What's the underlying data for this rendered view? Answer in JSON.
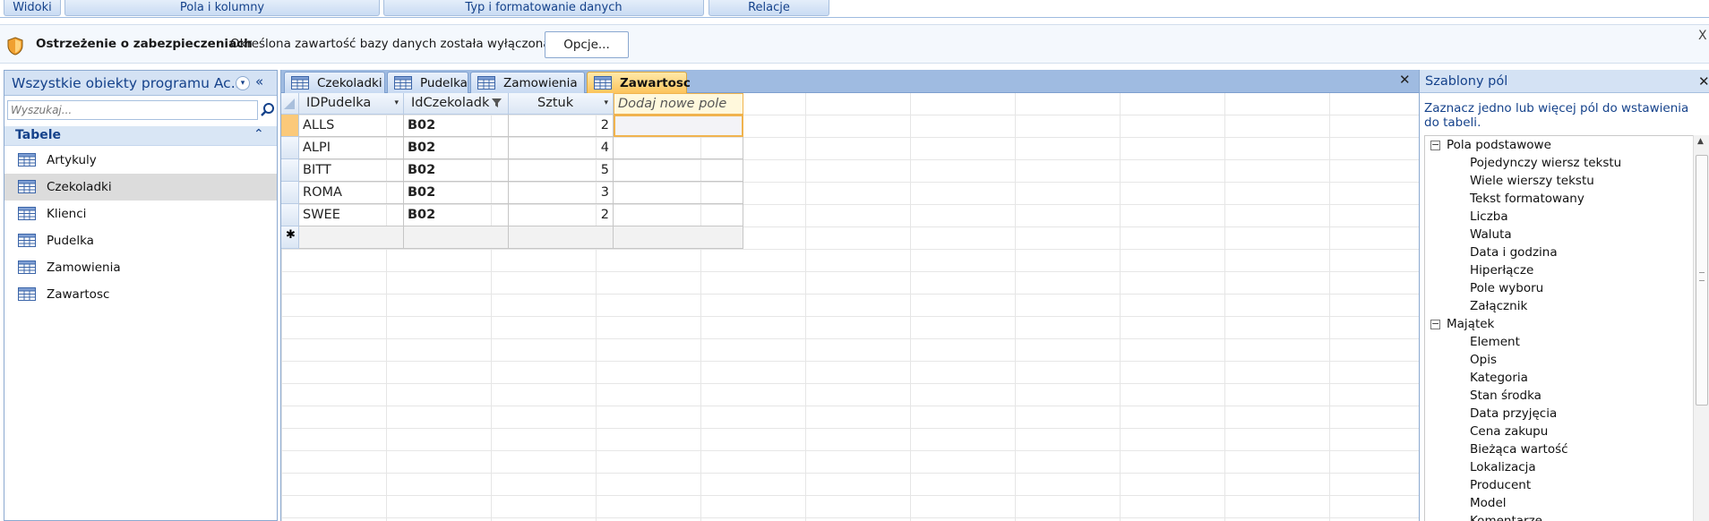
{
  "ribbon": {
    "groups": [
      "Widoki",
      "Pola i kolumny",
      "Typ i formatowanie danych",
      "Relacje"
    ]
  },
  "security_bar": {
    "title": "Ostrzeżenie o zabezpieczeniach",
    "message": "Określona zawartość bazy danych została wyłączona.",
    "options_label": "Opcje...",
    "close_glyph": "X"
  },
  "nav_pane": {
    "title": "Wszystkie obiekty programu Ac...",
    "dropdown_glyph": "▾",
    "collapse_glyph": "«",
    "search_placeholder": "Wyszukaj...",
    "group_title": "Tabele",
    "group_collapse_glyph": "⌃",
    "items": [
      {
        "label": "Artykuly",
        "selected": false
      },
      {
        "label": "Czekoladki",
        "selected": true
      },
      {
        "label": "Klienci",
        "selected": false
      },
      {
        "label": "Pudelka",
        "selected": false
      },
      {
        "label": "Zamowienia",
        "selected": false
      },
      {
        "label": "Zawartosc",
        "selected": false
      }
    ]
  },
  "doc_tabs": {
    "tabs": [
      {
        "label": "Czekoladki",
        "active": false
      },
      {
        "label": "Pudelka",
        "active": false
      },
      {
        "label": "Zamowienia",
        "active": false
      },
      {
        "label": "Zawartosc",
        "active": true
      }
    ],
    "close_glyph": "✕"
  },
  "datasheet": {
    "columns": [
      {
        "label": "IDPudelka",
        "indicator": "▾"
      },
      {
        "label": "IdCzekoladk",
        "indicator": "▾"
      },
      {
        "label": "Sztuk",
        "indicator": "▾"
      }
    ],
    "new_column_label": "Dodaj nowe pole",
    "rows": [
      [
        "ALLS",
        "B02",
        "2"
      ],
      [
        "ALPI",
        "B02",
        "4"
      ],
      [
        "BITT",
        "B02",
        "5"
      ],
      [
        "ROMA",
        "B02",
        "3"
      ],
      [
        "SWEE",
        "B02",
        "2"
      ]
    ],
    "new_row_marker": "✱"
  },
  "field_pane": {
    "title": "Szablony pól",
    "close_glyph": "✕",
    "description": "Zaznacz jedno lub więcej pól do wstawienia do tabeli.",
    "groups": [
      {
        "label": "Pola podstawowe",
        "expander": "−",
        "items": [
          "Pojedynczy wiersz tekstu",
          "Wiele wierszy tekstu",
          "Tekst formatowany",
          "Liczba",
          "Waluta",
          "Data i godzina",
          "Hiperłącze",
          "Pole wyboru",
          "Załącznik"
        ]
      },
      {
        "label": "Majątek",
        "expander": "−",
        "items": [
          "Element",
          "Opis",
          "Kategoria",
          "Stan środka",
          "Data przyjęcia",
          "Cena zakupu",
          "Bieżąca wartość",
          "Lokalizacja",
          "Producent",
          "Model",
          "Komentarze"
        ]
      }
    ]
  },
  "colors": {
    "accent": "#15428b",
    "active_tab": "#fcc45c",
    "pane_header": "#d4e2f4"
  }
}
